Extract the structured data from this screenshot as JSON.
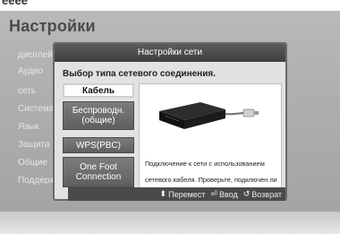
{
  "page": {
    "title": "Настройки",
    "top_fragment": "eeee"
  },
  "sidebar": {
    "items": [
      {
        "label": "дисплей"
      },
      {
        "label": "Аудио"
      },
      {
        "label": "сеть"
      },
      {
        "label": "Система"
      },
      {
        "label": "Язык"
      },
      {
        "label": "Защита"
      },
      {
        "label": "Общие"
      },
      {
        "label": "Поддержка"
      }
    ]
  },
  "dialog": {
    "title": "Настройки сети",
    "prompt": "Выбор типа сетевого соединения.",
    "options": [
      {
        "label": "Кабель",
        "selected": true
      },
      {
        "label": "Беспроводн. (общие)",
        "selected": false
      },
      {
        "label": "WPS(PBC)",
        "selected": false
      },
      {
        "label": "One Foot Connection",
        "selected": false
      }
    ],
    "description": "Подключение к сети с использованием сетевого кабеля. Проверьте, подключен ли сетевой кабель."
  },
  "footer": {
    "move_icon": "updown-arrows-icon",
    "move_label": "Перемест",
    "enter_icon": "enter-icon",
    "enter_label": "Ввод",
    "return_icon": "return-icon",
    "return_label": "Возврат"
  }
}
